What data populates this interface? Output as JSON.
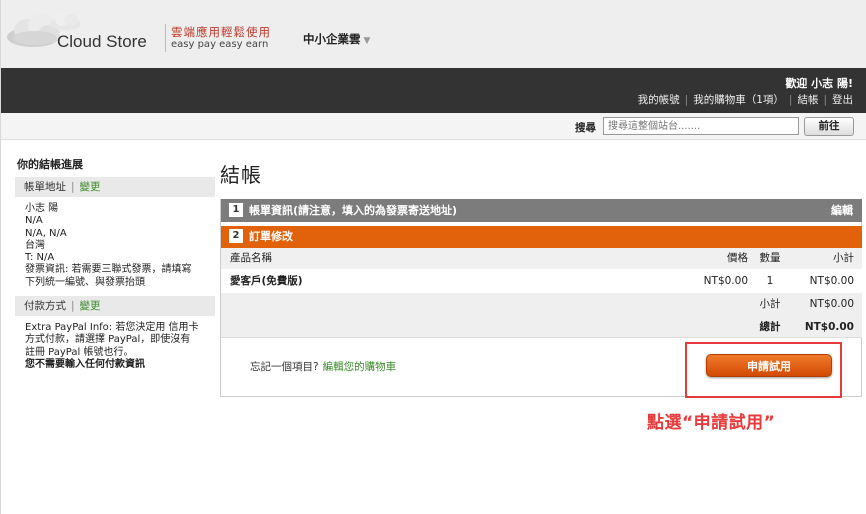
{
  "header": {
    "logo_text": "Cloud Store",
    "slogan_zh": "雲端應用輕鬆使用",
    "slogan_en": "easy pay easy earn",
    "site_menu": "中小企業雲"
  },
  "topbar": {
    "welcome": "歡迎 小志 陽!",
    "links": [
      "我的帳號",
      "我的購物車（1項）",
      "結帳",
      "登出"
    ]
  },
  "search": {
    "label": "搜尋",
    "placeholder": "搜尋這整個站台.......",
    "button": "前往"
  },
  "sidebar": {
    "title": "你的結帳進展",
    "edit_label": "變更",
    "billing": {
      "head": "帳單地址",
      "lines": [
        "小志 陽",
        "N/A",
        "N/A, N/A",
        "台灣",
        "T: N/A",
        "發票資訊: 若需要三聯式發票，請填寫",
        "下列統一編號、與發票抬頭"
      ]
    },
    "payment": {
      "head": "付款方式",
      "lines": [
        "Extra PayPal Info: 若您決定用 信用卡",
        "方式付款，請選擇 PayPal，即使沒有",
        "註冊 PayPal 帳號也行。"
      ],
      "note": "您不需要輸入任何付款資訊"
    }
  },
  "main": {
    "title": "結帳",
    "step1": {
      "num": "1",
      "label": "帳單資訊(請注意，填入的為發票寄送地址)",
      "edit": "編輯"
    },
    "step2": {
      "num": "2",
      "label": "訂單修改"
    },
    "table": {
      "headers": {
        "name": "產品名稱",
        "price": "價格",
        "qty": "數量",
        "subtotal": "小計"
      },
      "items": [
        {
          "name": "愛客戶(免費版)",
          "price": "NT$0.00",
          "qty": "1",
          "subtotal": "NT$0.00"
        }
      ],
      "subtotal_label": "小計",
      "subtotal_value": "NT$0.00",
      "total_label": "總計",
      "total_value": "NT$0.00"
    },
    "forgot_text": "忘記一個項目?",
    "forgot_link": "編輯您的購物車",
    "apply_button": "申請試用"
  },
  "callout": "點選“申請試用”",
  "colors": {
    "accent": "#e2620c",
    "highlight": "#e83a3a",
    "link": "#3b8b2a",
    "dark_bar": "#333333"
  }
}
